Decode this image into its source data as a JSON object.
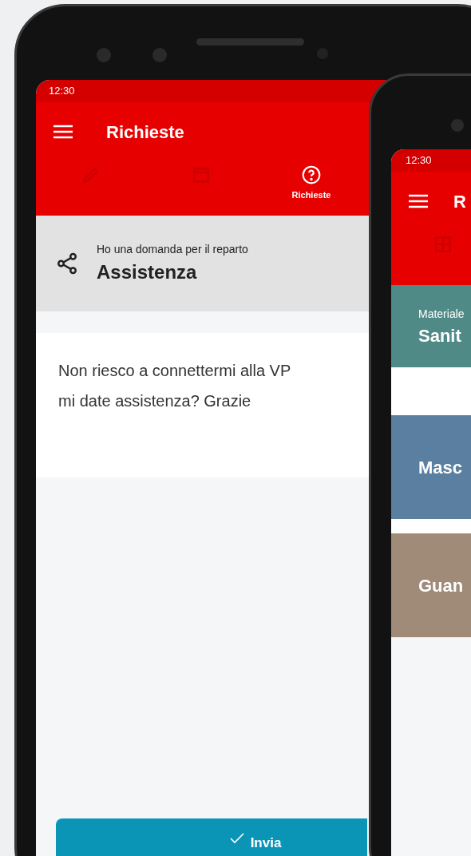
{
  "front_phone": {
    "status_bar": {
      "time": "12:30"
    },
    "header": {
      "title": "Richieste"
    },
    "tabs": [
      {
        "kind": "pencil",
        "selected": false
      },
      {
        "kind": "calendar",
        "selected": false
      },
      {
        "kind": "question",
        "label": "Richieste",
        "selected": true
      }
    ],
    "topic": {
      "subtitle": "Ho una domanda per il reparto",
      "title": "Assistenza"
    },
    "message_lines": [
      "Non riesco a connettermi alla VP",
      "mi date assistenza? Grazie"
    ],
    "submit_button": "Invia"
  },
  "back_phone": {
    "status_bar": {
      "time": "12:30"
    },
    "header": {
      "title": "R"
    },
    "tabs": [
      {
        "kind": "grid",
        "selected": false
      }
    ],
    "cards": [
      {
        "kind": "header",
        "caption": "Materiale",
        "title": "Sanit"
      },
      {
        "kind": "image",
        "title": "Masc"
      },
      {
        "kind": "image",
        "title": "Guan"
      }
    ]
  }
}
